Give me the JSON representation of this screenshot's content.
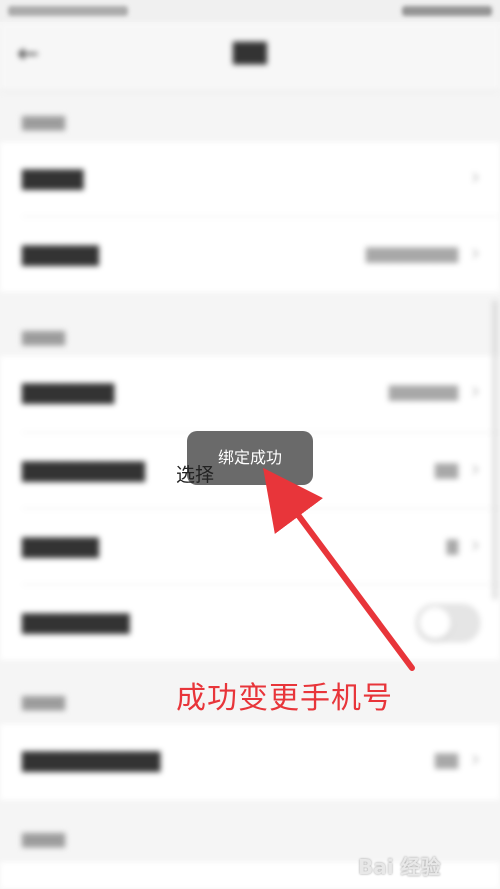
{
  "toast": {
    "text": "绑定成功"
  },
  "overlay": {
    "partial_text": "选择"
  },
  "annotation": {
    "text": "成功变更手机号",
    "color": "#e8353a"
  },
  "watermark": {
    "text": "Bai 经验"
  },
  "icons": {
    "back": "arrow-left-icon",
    "chevron": "chevron-right-icon"
  }
}
